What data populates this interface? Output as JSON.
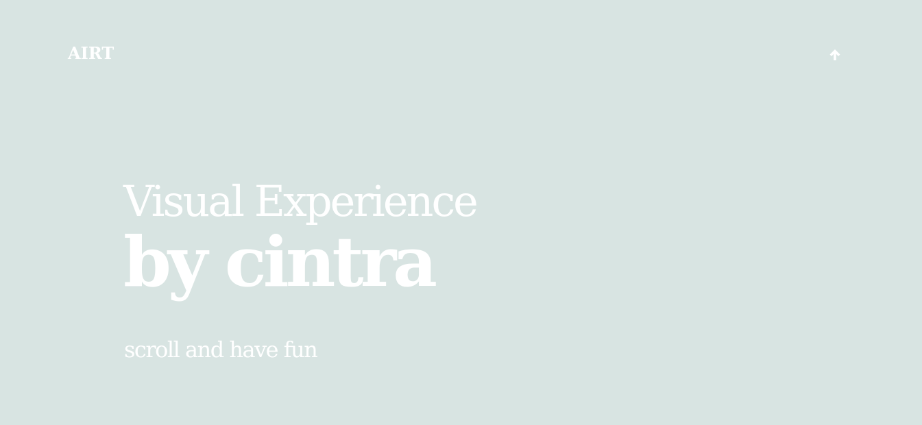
{
  "header": {
    "logo_text": "AIRT",
    "scroll_icon": "arrow-up-icon"
  },
  "hero": {
    "line1": "Visual Experience",
    "line2": "by cintra",
    "tagline": "scroll and have fun"
  },
  "colors": {
    "background": "#d8e4e2",
    "text": "#ffffff"
  }
}
